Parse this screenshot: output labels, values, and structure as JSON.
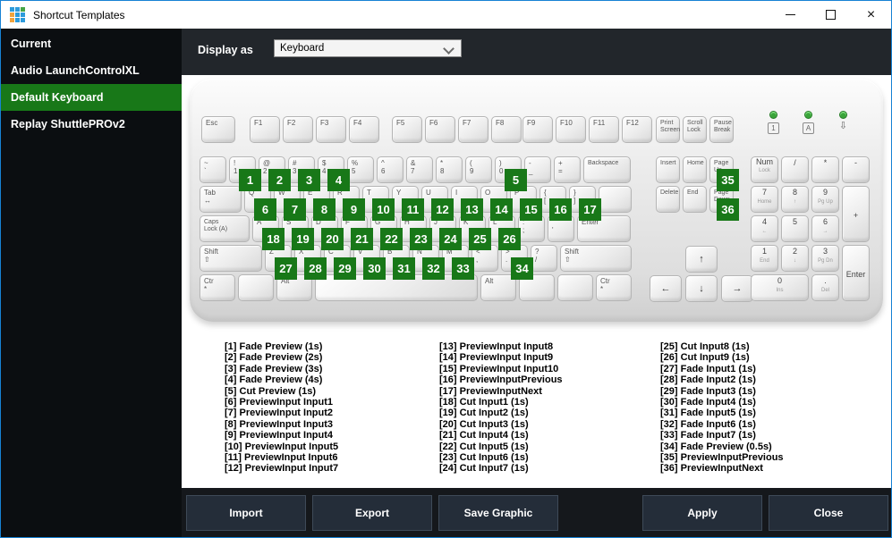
{
  "window": {
    "title": "Shortcut Templates",
    "icon": "app-grid-logo",
    "controls": [
      {
        "name": "minimize"
      },
      {
        "name": "maximize"
      },
      {
        "name": "close"
      }
    ]
  },
  "sidebar": {
    "items": [
      {
        "label": "Current",
        "selected": false
      },
      {
        "label": "Audio LaunchControlXL",
        "selected": false
      },
      {
        "label": "Default Keyboard",
        "selected": true
      },
      {
        "label": "Replay ShuttlePROv2",
        "selected": false
      }
    ]
  },
  "header": {
    "display_as_label": "Display as",
    "display_as_value": "Keyboard"
  },
  "keyboard": {
    "esc": {
      "l": [
        "Esc"
      ],
      "n": "esc"
    },
    "fkeys": [
      [
        "F1",
        "F2",
        "F3",
        "F4"
      ],
      [
        "F5",
        "F6",
        "F7",
        "F8"
      ],
      [
        "F9",
        "F10",
        "F11",
        "F12"
      ]
    ],
    "sys": [
      {
        "l": [
          "Print",
          "Screen"
        ],
        "small": true,
        "n": "print-screen"
      },
      {
        "l": [
          "Scroll",
          "Lock"
        ],
        "small": true,
        "n": "scroll-lock"
      },
      {
        "l": [
          "Pause",
          "Break"
        ],
        "small": true,
        "n": "pause-break"
      }
    ],
    "leds": [
      {
        "symbol": "1",
        "boxed": true,
        "name": "num-lock-led"
      },
      {
        "symbol": "A",
        "boxed": true,
        "name": "caps-lock-led"
      },
      {
        "symbol": "⇩",
        "boxed": false,
        "name": "scroll-lock-led"
      }
    ],
    "main_rows": [
      [
        {
          "l": [
            "~",
            "`"
          ],
          "n": "backtick"
        },
        {
          "l": [
            "!",
            "1"
          ],
          "badge": 1,
          "n": "1"
        },
        {
          "l": [
            "@",
            "2"
          ],
          "badge": 2,
          "n": "2"
        },
        {
          "l": [
            "#",
            "3"
          ],
          "badge": 3,
          "n": "3"
        },
        {
          "l": [
            "$",
            "4"
          ],
          "badge": 4,
          "n": "4"
        },
        {
          "l": [
            "%",
            "5"
          ],
          "n": "5"
        },
        {
          "l": [
            "^",
            "6"
          ],
          "n": "6"
        },
        {
          "l": [
            "&",
            "7"
          ],
          "n": "7"
        },
        {
          "l": [
            "*",
            "8"
          ],
          "n": "8"
        },
        {
          "l": [
            "(",
            "9"
          ],
          "n": "9"
        },
        {
          "l": [
            ")",
            "0"
          ],
          "badge": 5,
          "n": "0"
        },
        {
          "l": [
            "-",
            "_"
          ],
          "n": "minus"
        },
        {
          "l": [
            "+",
            "="
          ],
          "n": "equals"
        },
        {
          "l": [
            "Backspace"
          ],
          "w": 1.7,
          "small": true,
          "n": "backspace"
        }
      ],
      [
        {
          "l": [
            "Tab",
            "↔"
          ],
          "w": 1.5,
          "n": "tab"
        },
        {
          "l": [
            "Q"
          ],
          "badge": 6,
          "n": "q"
        },
        {
          "l": [
            "W"
          ],
          "badge": 7,
          "n": "w"
        },
        {
          "l": [
            "E"
          ],
          "badge": 8,
          "n": "e"
        },
        {
          "l": [
            "R"
          ],
          "badge": 9,
          "n": "r"
        },
        {
          "l": [
            "T"
          ],
          "badge": 10,
          "n": "t"
        },
        {
          "l": [
            "Y"
          ],
          "badge": 11,
          "n": "y"
        },
        {
          "l": [
            "U"
          ],
          "badge": 12,
          "n": "u"
        },
        {
          "l": [
            "I"
          ],
          "badge": 13,
          "n": "i"
        },
        {
          "l": [
            "O"
          ],
          "badge": 14,
          "n": "o"
        },
        {
          "l": [
            "P"
          ],
          "badge": 15,
          "n": "p"
        },
        {
          "l": [
            "{",
            "["
          ],
          "badge": 16,
          "n": "bracket-open"
        },
        {
          "l": [
            "}",
            "]"
          ],
          "badge": 17,
          "n": "bracket-close"
        },
        {
          "l": [
            ""
          ],
          "w": 1.2,
          "n": "backslash"
        }
      ],
      [
        {
          "l": [
            "Caps",
            "Lock (A)"
          ],
          "w": 1.8,
          "small": true,
          "n": "caps-lock"
        },
        {
          "l": [
            "A"
          ],
          "badge": 18,
          "n": "a"
        },
        {
          "l": [
            "S"
          ],
          "badge": 19,
          "n": "s"
        },
        {
          "l": [
            "D"
          ],
          "badge": 20,
          "n": "d"
        },
        {
          "l": [
            "F"
          ],
          "badge": 21,
          "n": "f"
        },
        {
          "l": [
            "G"
          ],
          "badge": 22,
          "n": "g"
        },
        {
          "l": [
            "H"
          ],
          "badge": 23,
          "n": "h"
        },
        {
          "l": [
            "J"
          ],
          "badge": 24,
          "n": "j"
        },
        {
          "l": [
            "K"
          ],
          "badge": 25,
          "n": "k"
        },
        {
          "l": [
            "L"
          ],
          "badge": 26,
          "n": "l"
        },
        {
          "l": [
            ":",
            ";"
          ],
          "n": "semicolon"
        },
        {
          "l": [
            "\"",
            "'"
          ],
          "n": "quote"
        },
        {
          "l": [
            "Enter"
          ],
          "w": 1.9,
          "n": "enter"
        }
      ],
      [
        {
          "l": [
            "Shift",
            "⇧"
          ],
          "w": 2.2,
          "n": "shift-left"
        },
        {
          "l": [
            "Z"
          ],
          "badge": 27,
          "n": "z"
        },
        {
          "l": [
            "X"
          ],
          "badge": 28,
          "n": "x"
        },
        {
          "l": [
            "C"
          ],
          "badge": 29,
          "n": "c"
        },
        {
          "l": [
            "V"
          ],
          "badge": 30,
          "n": "v"
        },
        {
          "l": [
            "B"
          ],
          "badge": 31,
          "n": "b"
        },
        {
          "l": [
            "N"
          ],
          "badge": 32,
          "n": "n"
        },
        {
          "l": [
            "M"
          ],
          "badge": 33,
          "n": "m"
        },
        {
          "l": [
            "<",
            ","
          ],
          "n": "comma"
        },
        {
          "l": [
            ">",
            "."
          ],
          "badge": 34,
          "n": "period"
        },
        {
          "l": [
            "?",
            "/"
          ],
          "n": "slash"
        },
        {
          "l": [
            "Shift",
            "⇧"
          ],
          "w": 2.5,
          "n": "shift-right"
        }
      ],
      [
        {
          "l": [
            "Ctr",
            "*"
          ],
          "w": 1.3,
          "n": "ctrl-left"
        },
        {
          "l": [
            ""
          ],
          "w": 1.3,
          "n": "win-left"
        },
        {
          "l": [
            "Alt"
          ],
          "w": 1.3,
          "n": "alt-left"
        },
        {
          "l": [
            ""
          ],
          "w": 5.6,
          "n": "space"
        },
        {
          "l": [
            "Alt"
          ],
          "w": 1.3,
          "n": "alt-right"
        },
        {
          "l": [
            ""
          ],
          "w": 1.3,
          "n": "win-right"
        },
        {
          "l": [
            ""
          ],
          "w": 1.3,
          "n": "menu"
        },
        {
          "l": [
            "Ctr",
            "*"
          ],
          "w": 1.3,
          "n": "ctrl-right"
        }
      ]
    ],
    "nav_rows": [
      [
        {
          "l": [
            "Insert"
          ],
          "small": true,
          "n": "insert"
        },
        {
          "l": [
            "Home"
          ],
          "small": true,
          "n": "home"
        },
        {
          "l": [
            "Page",
            "Up"
          ],
          "small": true,
          "badge": 35,
          "n": "page-up"
        }
      ],
      [
        {
          "l": [
            "Delete"
          ],
          "small": true,
          "n": "delete"
        },
        {
          "l": [
            "End"
          ],
          "small": true,
          "n": "end"
        },
        {
          "l": [
            "Page",
            "Down"
          ],
          "small": true,
          "badge": 36,
          "n": "page-down"
        }
      ]
    ],
    "arrows": [
      {
        "g": "↑",
        "n": "arrow-up"
      },
      {
        "g": "←",
        "n": "arrow-left"
      },
      {
        "g": "↓",
        "n": "arrow-down"
      },
      {
        "g": "→",
        "n": "arrow-right"
      }
    ],
    "numpad_rows": [
      [
        {
          "l": [
            "Num",
            "Lock"
          ],
          "small": true,
          "n": "num-lock"
        },
        {
          "l": [
            "/"
          ],
          "n": "np-divide"
        },
        {
          "l": [
            "*"
          ],
          "n": "np-multiply"
        },
        {
          "l": [
            "-"
          ],
          "n": "np-subtract"
        }
      ],
      [
        {
          "l": [
            "7",
            "Home"
          ],
          "n": "np-7"
        },
        {
          "l": [
            "8",
            "↑"
          ],
          "n": "np-8"
        },
        {
          "l": [
            "9",
            "Pg Up"
          ],
          "n": "np-9"
        },
        {
          "l": [
            "+"
          ],
          "h": 2,
          "n": "np-add"
        }
      ],
      [
        {
          "l": [
            "4",
            "←"
          ],
          "n": "np-4"
        },
        {
          "l": [
            "5"
          ],
          "n": "np-5"
        },
        {
          "l": [
            "6",
            "→"
          ],
          "n": "np-6"
        }
      ],
      [
        {
          "l": [
            "1",
            "End"
          ],
          "n": "np-1"
        },
        {
          "l": [
            "2",
            "↓"
          ],
          "n": "np-2"
        },
        {
          "l": [
            "3",
            "Pg Dn"
          ],
          "n": "np-3"
        },
        {
          "l": [
            "Enter"
          ],
          "h": 2,
          "small": true,
          "n": "np-enter"
        }
      ],
      [
        {
          "l": [
            "0",
            "Ins"
          ],
          "w2": true,
          "n": "np-0"
        },
        {
          "l": [
            ".",
            "Del"
          ],
          "n": "np-decimal"
        }
      ]
    ]
  },
  "legend": {
    "columns": [
      [
        "[1] Fade Preview (1s)",
        "[2] Fade Preview (2s)",
        "[3] Fade Preview (3s)",
        "[4] Fade Preview (4s)",
        "[5] Cut Preview (1s)",
        "[6] PreviewInput Input1",
        "[7] PreviewInput Input2",
        "[8] PreviewInput Input3",
        "[9] PreviewInput Input4",
        "[10] PreviewInput Input5",
        "[11] PreviewInput Input6",
        "[12] PreviewInput Input7"
      ],
      [
        "[13] PreviewInput Input8",
        "[14] PreviewInput Input9",
        "[15] PreviewInput Input10",
        "[16] PreviewInputPrevious",
        "[17] PreviewInputNext",
        "[18] Cut Input1 (1s)",
        "[19] Cut Input2 (1s)",
        "[20] Cut Input3 (1s)",
        "[21] Cut Input4 (1s)",
        "[22] Cut Input5 (1s)",
        "[23] Cut Input6 (1s)",
        "[24] Cut Input7 (1s)"
      ],
      [
        "[25] Cut Input8 (1s)",
        "[26] Cut Input9 (1s)",
        "[27] Fade Input1 (1s)",
        "[28] Fade Input2 (1s)",
        "[29] Fade Input3 (1s)",
        "[30] Fade Input4 (1s)",
        "[31] Fade Input5 (1s)",
        "[32] Fade Input6 (1s)",
        "[33] Fade Input7 (1s)",
        "[34] Fade Preview (0.5s)",
        "[35] PreviewInputPrevious",
        "[36] PreviewInputNext"
      ]
    ]
  },
  "footer": {
    "buttons": [
      {
        "label": "Import"
      },
      {
        "label": "Export"
      },
      {
        "label": "Save Graphic"
      },
      {
        "label": "Apply"
      },
      {
        "label": "Close"
      }
    ]
  },
  "colors": {
    "selection_green": "#187818",
    "badge_green": "#187818",
    "window_border_blue": "#1782d4",
    "header_dark": "#22262b",
    "footer_dark": "#15181c",
    "button_bg": "#242d39",
    "button_border": "#3e4a58"
  }
}
